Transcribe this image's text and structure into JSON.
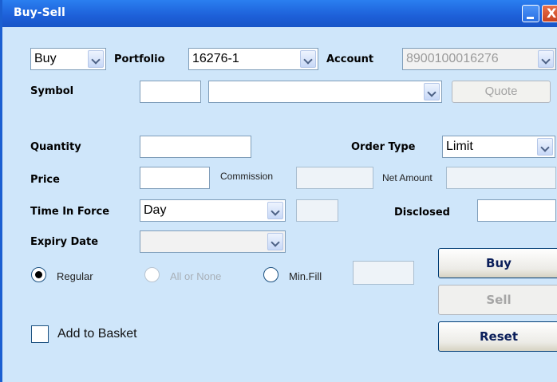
{
  "window": {
    "title": "Buy-Sell",
    "minimize_icon": "minimize-icon",
    "close_icon": "close-icon",
    "close_glyph": "X"
  },
  "row1": {
    "side_value": "Buy",
    "portfolio_label": "Portfolio",
    "portfolio_value": "16276-1",
    "account_label": "Account",
    "account_value": "8900100016276"
  },
  "symbol": {
    "label": "Symbol",
    "code_value": "",
    "name_value": "",
    "quote_label": "Quote"
  },
  "order": {
    "quantity_label": "Quantity",
    "quantity_value": "",
    "order_type_label": "Order Type",
    "order_type_value": "Limit",
    "price_label": "Price",
    "price_value": "",
    "commission_label": "Commission",
    "commission_value": "",
    "net_amount_label": "Net Amount",
    "net_amount_value": "",
    "tif_label": "Time In Force",
    "tif_value": "Day",
    "tif_extra_value": "",
    "disclosed_label": "Disclosed",
    "disclosed_value": "",
    "expiry_label": "Expiry Date",
    "expiry_value": ""
  },
  "fill_type": {
    "regular_label": "Regular",
    "aon_label": "All or None",
    "minfill_label": "Min.Fill",
    "minfill_value": "",
    "selected": "Regular"
  },
  "basket": {
    "label": "Add to Basket",
    "checked": false
  },
  "actions": {
    "buy_label": "Buy",
    "sell_label": "Sell",
    "reset_label": "Reset"
  },
  "colors": {
    "title_bar": "#1d5fd8",
    "panel": "#cfe6fa",
    "button_text": "#0a1e5a"
  }
}
